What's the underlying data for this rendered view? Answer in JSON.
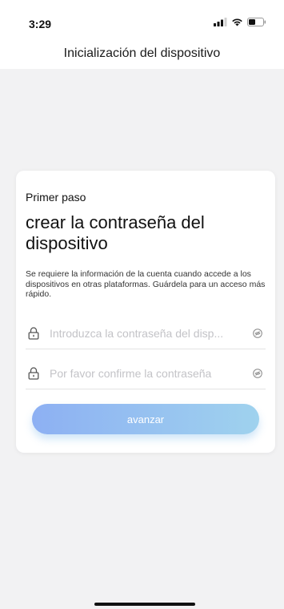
{
  "status_bar": {
    "time": "3:29",
    "icons": [
      "signal-icon",
      "wifi-icon",
      "battery-icon"
    ]
  },
  "header": {
    "title": "Inicialización del dispositivo"
  },
  "card": {
    "step_label": "Primer paso",
    "title": "crear la contraseña del dispositivo",
    "description": "Se requiere la información de la cuenta cuando accede a los dispositivos en otras plataformas. Guárdela para un acceso más rápido.",
    "password_field": {
      "placeholder": "Introduzca la contraseña del disp...",
      "value": ""
    },
    "confirm_field": {
      "placeholder": "Por favor confirme la contraseña",
      "value": ""
    },
    "advance_label": "avanzar"
  },
  "colors": {
    "button_gradient_start": "#8db0f3",
    "button_gradient_end": "#9fd2ee",
    "background": "#f2f2f3"
  }
}
